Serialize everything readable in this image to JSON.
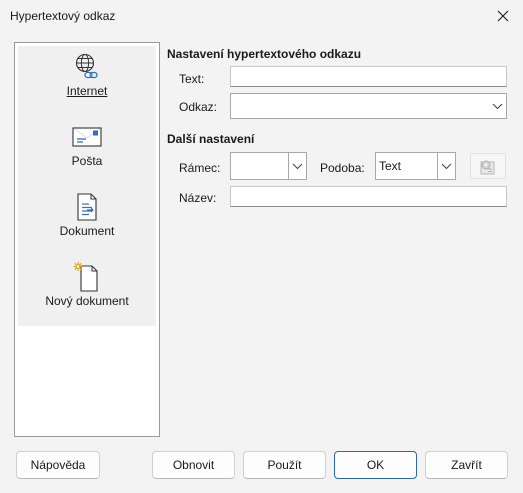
{
  "window": {
    "title": "Hypertextový odkaz"
  },
  "sidebar": {
    "items": [
      {
        "label": "Internet",
        "icon": "globe-link-icon"
      },
      {
        "label": "Pošta",
        "icon": "envelope-icon"
      },
      {
        "label": "Dokument",
        "icon": "document-icon"
      },
      {
        "label": "Nový dokument",
        "icon": "new-document-icon"
      }
    ]
  },
  "settings": {
    "title": "Nastavení hypertextového odkazu",
    "text_label": "Text:",
    "text_value": "",
    "link_label": "Odkaz:",
    "link_value": ""
  },
  "further": {
    "title": "Další nastavení",
    "frame_label": "Rámec:",
    "frame_value": "",
    "form_label": "Podoba:",
    "form_value": "Text",
    "name_label": "Název:",
    "name_value": ""
  },
  "buttons": {
    "help": "Nápověda",
    "reset": "Obnovit",
    "apply": "Použít",
    "ok": "OK",
    "close": "Zavřít"
  }
}
